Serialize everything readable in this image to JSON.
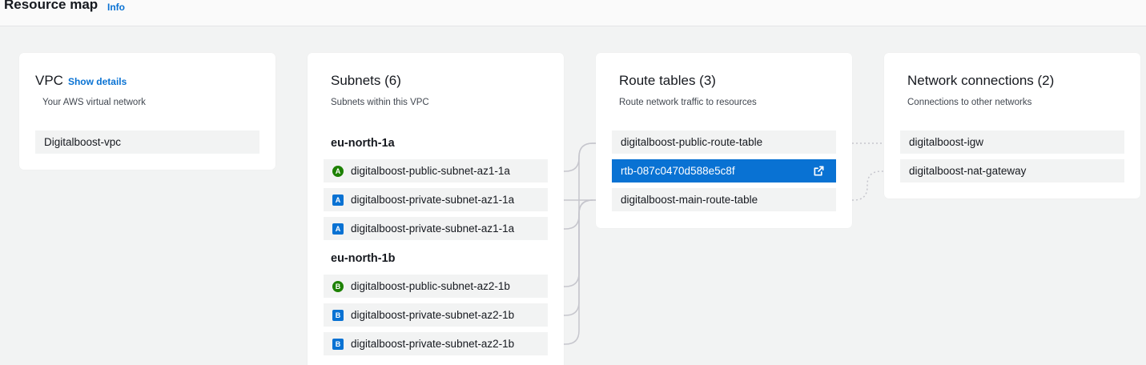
{
  "header": {
    "title": "Resource map",
    "info_label": "Info"
  },
  "vpc": {
    "title": "VPC",
    "show_details_label": "Show details",
    "subtitle": "Your AWS virtual network",
    "items": [
      {
        "label": "Digitalboost-vpc"
      }
    ]
  },
  "subnets": {
    "title": "Subnets (6)",
    "subtitle": "Subnets within this VPC",
    "groups": [
      {
        "name": "eu-north-1a",
        "items": [
          {
            "badge": "A",
            "type": "public",
            "label": "digitalboost-public-subnet-az1-1a"
          },
          {
            "badge": "A",
            "type": "private",
            "label": "digitalboost-private-subnet-az1-1a"
          },
          {
            "badge": "A",
            "type": "private",
            "label": "digitalboost-private-subnet-az1-1a"
          }
        ]
      },
      {
        "name": "eu-north-1b",
        "items": [
          {
            "badge": "B",
            "type": "public",
            "label": "digitalboost-public-subnet-az2-1b"
          },
          {
            "badge": "B",
            "type": "private",
            "label": "digitalboost-private-subnet-az2-1b"
          },
          {
            "badge": "B",
            "type": "private",
            "label": "digitalboost-private-subnet-az2-1b"
          }
        ]
      }
    ]
  },
  "route_tables": {
    "title": "Route tables (3)",
    "subtitle": "Route network traffic to resources",
    "items": [
      {
        "label": "digitalboost-public-route-table",
        "selected": false
      },
      {
        "label": "rtb-087c0470d588e5c8f",
        "selected": true,
        "icon": "external-link-icon"
      },
      {
        "label": "digitalboost-main-route-table",
        "selected": false
      }
    ]
  },
  "network_connections": {
    "title": "Network connections (2)",
    "subtitle": "Connections to other networks",
    "items": [
      {
        "label": "digitalboost-igw"
      },
      {
        "label": "digitalboost-nat-gateway"
      }
    ]
  },
  "colors": {
    "accent": "#0972d3",
    "public_badge": "#1d8102",
    "connector": "#c6c6cd",
    "background": "#f2f3f3"
  }
}
